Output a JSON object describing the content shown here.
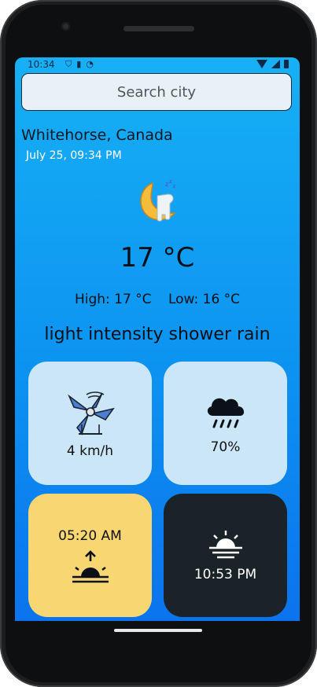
{
  "status_bar": {
    "time": "10:34"
  },
  "search": {
    "placeholder": "Search city"
  },
  "location": {
    "city": "Whitehorse, Canada",
    "datetime": "July 25, 09:34 PM"
  },
  "current": {
    "temperature": "17 °C",
    "high": "High: 17 °C",
    "low": "Low: 16 °C",
    "description": "light intensity shower rain",
    "icon": "moon-night-icon"
  },
  "cards": {
    "wind": {
      "value": "4 km/h",
      "icon": "windmill-icon"
    },
    "humidity": {
      "value": "70%",
      "icon": "rain-cloud-icon"
    },
    "sunrise": {
      "value": "05:20 AM",
      "icon": "sunrise-icon"
    },
    "sunset": {
      "value": "10:53 PM",
      "icon": "sunset-icon"
    }
  },
  "colors": {
    "background_top": "#17b0f5",
    "background_bottom": "#0b73ee",
    "card_light": "#cbe7f7",
    "card_sunrise": "#f8d772",
    "card_sunset": "#1a2428"
  }
}
